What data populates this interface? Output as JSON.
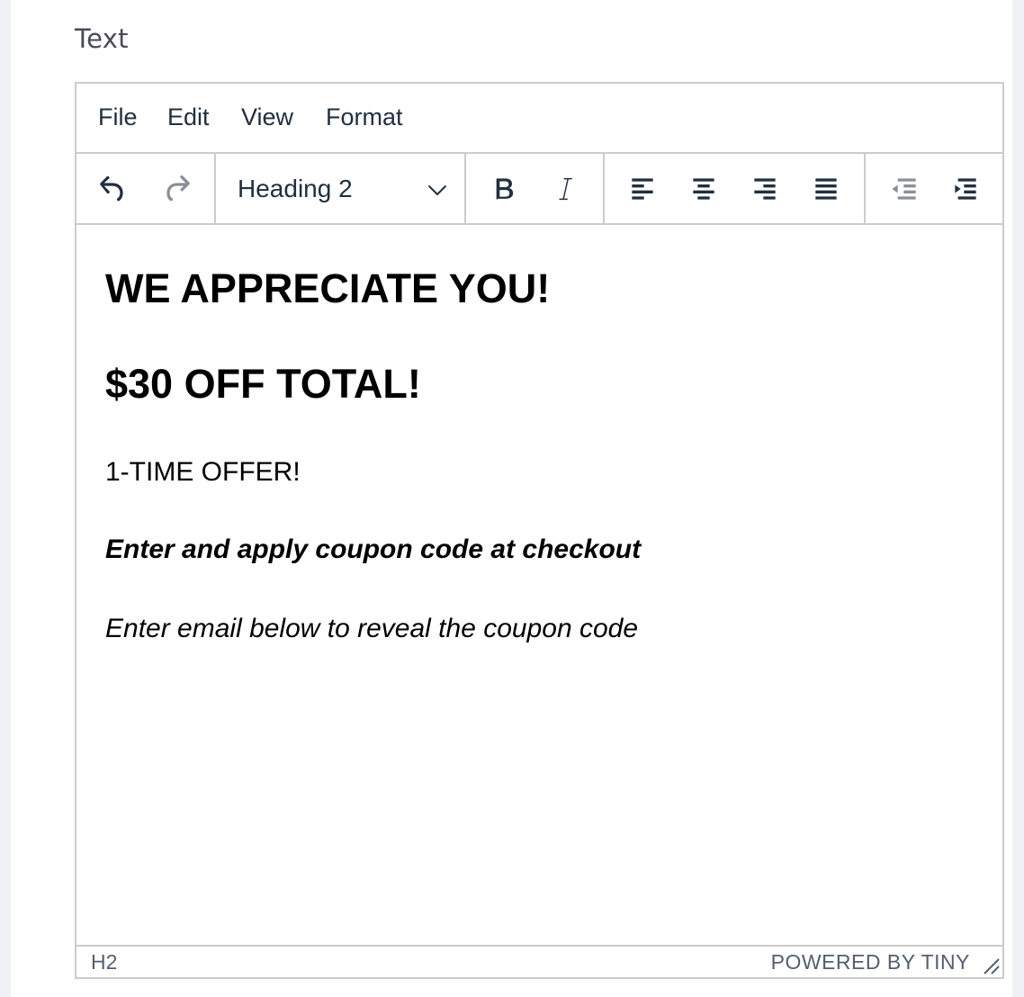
{
  "field": {
    "label": "Text"
  },
  "menubar": {
    "items": [
      "File",
      "Edit",
      "View",
      "Format"
    ]
  },
  "toolbar": {
    "block_format": "Heading 2",
    "buttons": {
      "undo": "undo-icon",
      "redo": "redo-icon",
      "bold": "bold-icon",
      "italic": "italic-icon",
      "align_left": "align-left-icon",
      "align_center": "align-center-icon",
      "align_right": "align-right-icon",
      "align_justify": "align-justify-icon",
      "outdent": "outdent-icon",
      "indent": "indent-icon"
    },
    "disabled": [
      "redo",
      "outdent"
    ]
  },
  "content": {
    "heading1": "WE APPRECIATE YOU!",
    "heading2": "$30 OFF TOTAL!",
    "para1": "1-TIME OFFER!",
    "para2": "Enter and apply coupon code at checkout",
    "para3": "Enter email below to reveal the coupon code"
  },
  "statusbar": {
    "path": "H2",
    "branding": "POWERED BY TINY"
  },
  "colors": {
    "icon": "#222f3e",
    "icon_disabled": "#8a9097",
    "border": "#cccccc",
    "page_bg": "#eef2f4"
  }
}
